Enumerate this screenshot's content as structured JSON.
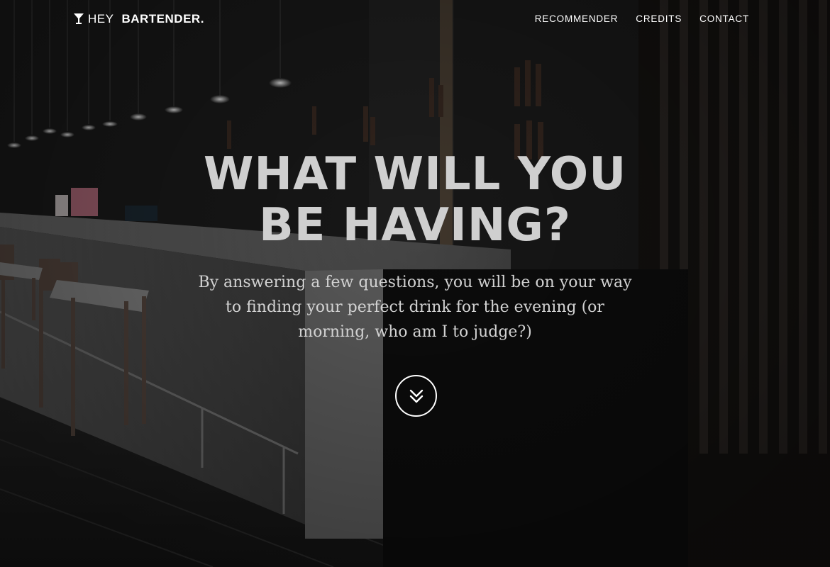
{
  "brand": {
    "light": "HEY",
    "bold": "BARTENDER.",
    "icon": "cocktail-glass-icon"
  },
  "nav": {
    "items": [
      {
        "label": "RECOMMENDER"
      },
      {
        "label": "CREDITS"
      },
      {
        "label": "CONTACT"
      }
    ]
  },
  "hero": {
    "title_line1": "WHAT WILL YOU",
    "title_line2": "BE HAVING?",
    "subtitle": "By answering a few questions, you will be on your way to finding your perfect drink for the evening (or morning, who am I to judge?)",
    "scroll_icon": "double-chevron-down-icon"
  },
  "colors": {
    "text": "#ffffff",
    "title": "#cfcfcf",
    "subtitle": "#d2d2d2",
    "background": "#141414"
  }
}
